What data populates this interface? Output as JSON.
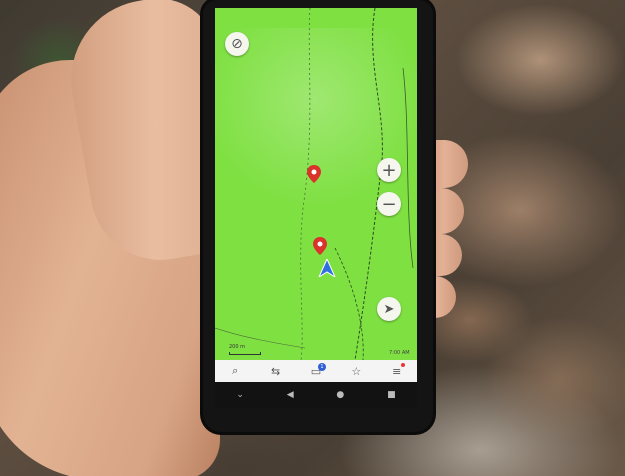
{
  "map": {
    "scale_label": "200 m",
    "status_text": "7:00 AM"
  },
  "controls": {
    "zoom_in_label": "+",
    "zoom_out_label": "−",
    "layers_icon": "layers-off-icon",
    "locate_icon": "navigation-arrow-icon"
  },
  "bottom_nav": {
    "items": [
      {
        "icon": "search-icon",
        "glyph": "⌕"
      },
      {
        "icon": "route-icon",
        "glyph": "⇆"
      },
      {
        "icon": "tracks-icon",
        "glyph": "▭",
        "badge": "1"
      },
      {
        "icon": "favorites-icon",
        "glyph": "☆"
      },
      {
        "icon": "menu-icon",
        "glyph": "≡"
      }
    ]
  },
  "system_nav": {
    "items": [
      {
        "icon": "chevron-down-icon",
        "glyph": "⌄"
      },
      {
        "icon": "back-icon",
        "glyph": "◀"
      },
      {
        "icon": "home-icon",
        "glyph": "●"
      },
      {
        "icon": "recents-icon",
        "glyph": "■"
      }
    ]
  },
  "colors": {
    "map_background": "#7fe042",
    "pin": "#d9332b",
    "location_arrow": "#2f6fe0"
  }
}
